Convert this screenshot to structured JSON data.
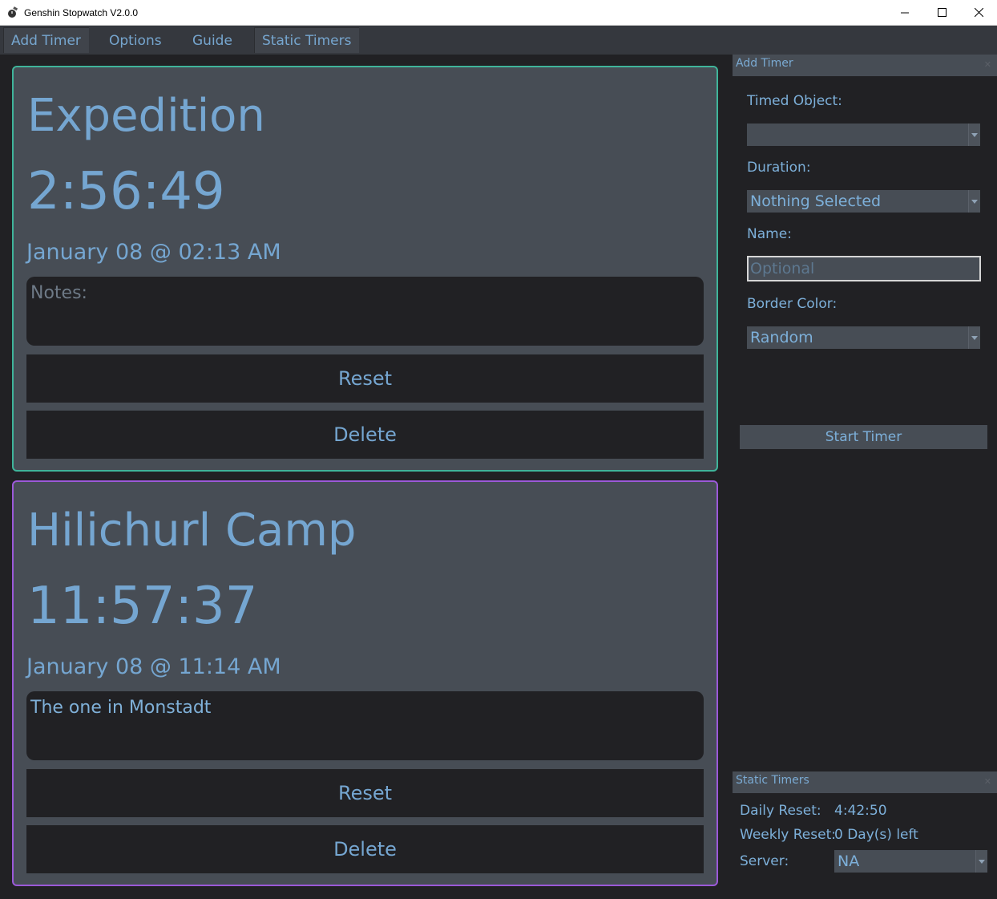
{
  "window": {
    "title": "Genshin Stopwatch V2.0.0"
  },
  "menu": {
    "items": [
      {
        "label": "Add Timer"
      },
      {
        "label": "Options"
      },
      {
        "label": "Guide"
      },
      {
        "label": "Static Timers"
      }
    ]
  },
  "timers": [
    {
      "name": "Expedition",
      "time": "2:56:49",
      "date": "January 08 @ 02:13 AM",
      "notes": "Notes:",
      "border_color": "#3fb49a",
      "reset_label": "Reset",
      "delete_label": "Delete"
    },
    {
      "name": "Hilichurl Camp",
      "time": "11:57:37",
      "date": "January 08 @ 11:14 AM",
      "notes": "The one in Monstadt",
      "border_color": "#9b59d8",
      "reset_label": "Reset",
      "delete_label": "Delete"
    }
  ],
  "add_timer_panel": {
    "title": "Add Timer",
    "timed_object_label": "Timed Object:",
    "timed_object_value": "",
    "duration_label": "Duration:",
    "duration_value": "Nothing Selected",
    "name_label": "Name:",
    "name_placeholder": "Optional",
    "border_color_label": "Border Color:",
    "border_color_value": "Random",
    "start_button": "Start Timer"
  },
  "static_timers_panel": {
    "title": "Static Timers",
    "daily_reset_label": "Daily Reset:",
    "daily_reset_value": "4:42:50",
    "weekly_reset_label": "Weekly Reset:",
    "weekly_reset_value": "0 Day(s) left",
    "server_label": "Server:",
    "server_value": "NA"
  },
  "colors": {
    "background": "#212124",
    "panel": "#474d55",
    "text_accent": "#75a6d1"
  }
}
